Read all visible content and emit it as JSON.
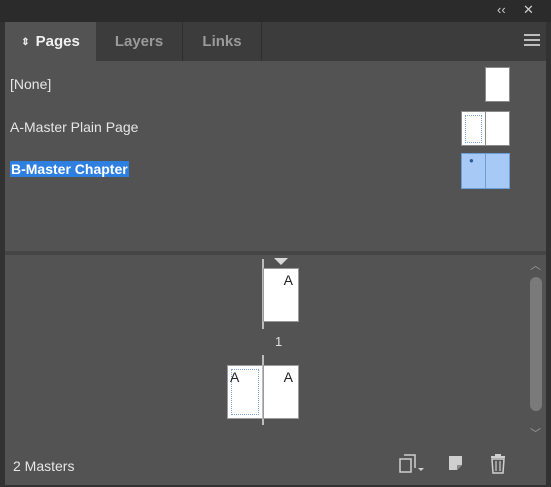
{
  "window": {
    "collapse_icon": "double-chevron-left-icon",
    "close_icon": "close-icon"
  },
  "tabs": [
    {
      "label": "Pages",
      "active": true
    },
    {
      "label": "Layers",
      "active": false
    },
    {
      "label": "Links",
      "active": false
    }
  ],
  "masters": [
    {
      "label": "[None]",
      "selected": false
    },
    {
      "label": "A-Master Plain Page",
      "selected": false
    },
    {
      "label": "B-Master Chapter",
      "selected": true
    }
  ],
  "pages": [
    {
      "number": "1",
      "applied_master": "A"
    },
    {
      "number": "",
      "applied_master": "A"
    },
    {
      "number": "",
      "applied_master": "A"
    }
  ],
  "footer": {
    "status": "2 Masters",
    "buttons": [
      "edit-page-size-icon",
      "new-page-icon",
      "trash-icon"
    ]
  },
  "colors": {
    "selection": "#2d7fe0",
    "panel_bg": "#535353",
    "tab_bar_bg": "#3c3c3c"
  }
}
